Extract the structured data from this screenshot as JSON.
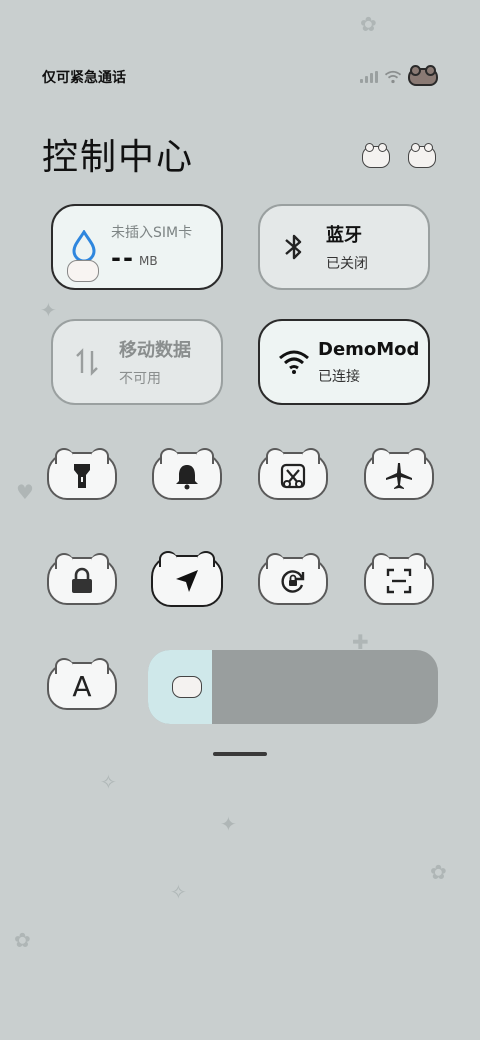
{
  "status_bar": {
    "carrier": "仅可紧急通话",
    "signal_icon": "signal-icon",
    "wifi_icon": "wifi-icon",
    "battery_icon": "cat-battery-icon"
  },
  "title": "控制中心",
  "tiles": {
    "sim": {
      "label": "未插入SIM卡",
      "value": "--",
      "unit": "MB",
      "icon": "water-drop-icon",
      "accent": "#2e86de"
    },
    "bluetooth": {
      "title": "蓝牙",
      "status": "已关闭",
      "icon": "bluetooth-icon"
    },
    "mobile_data": {
      "title": "移动数据",
      "status": "不可用",
      "icon": "data-arrows-icon"
    },
    "wifi": {
      "title": "DemoMod",
      "status": "已连接",
      "icon": "wifi-icon"
    }
  },
  "quick_toggles": [
    {
      "name": "flashlight",
      "icon": "flashlight-icon"
    },
    {
      "name": "mute",
      "icon": "bell-icon"
    },
    {
      "name": "screenshot",
      "icon": "scissors-icon"
    },
    {
      "name": "airplane-mode",
      "icon": "airplane-icon"
    },
    {
      "name": "lock-screen",
      "icon": "lock-icon"
    },
    {
      "name": "location",
      "icon": "location-arrow-icon"
    },
    {
      "name": "auto-rotate",
      "icon": "rotation-lock-icon"
    },
    {
      "name": "scan",
      "icon": "scan-icon"
    },
    {
      "name": "font-size",
      "icon": "letter-a-icon"
    }
  ],
  "font_toggle_label": "A",
  "brightness": {
    "level": 0.22,
    "icon": "cat-face-icon"
  },
  "colors": {
    "background": "#c9cfcf",
    "tile_border": "#2b2b2b",
    "slider_fill": "#cfe8ea",
    "slider_track": "#999e9e"
  }
}
